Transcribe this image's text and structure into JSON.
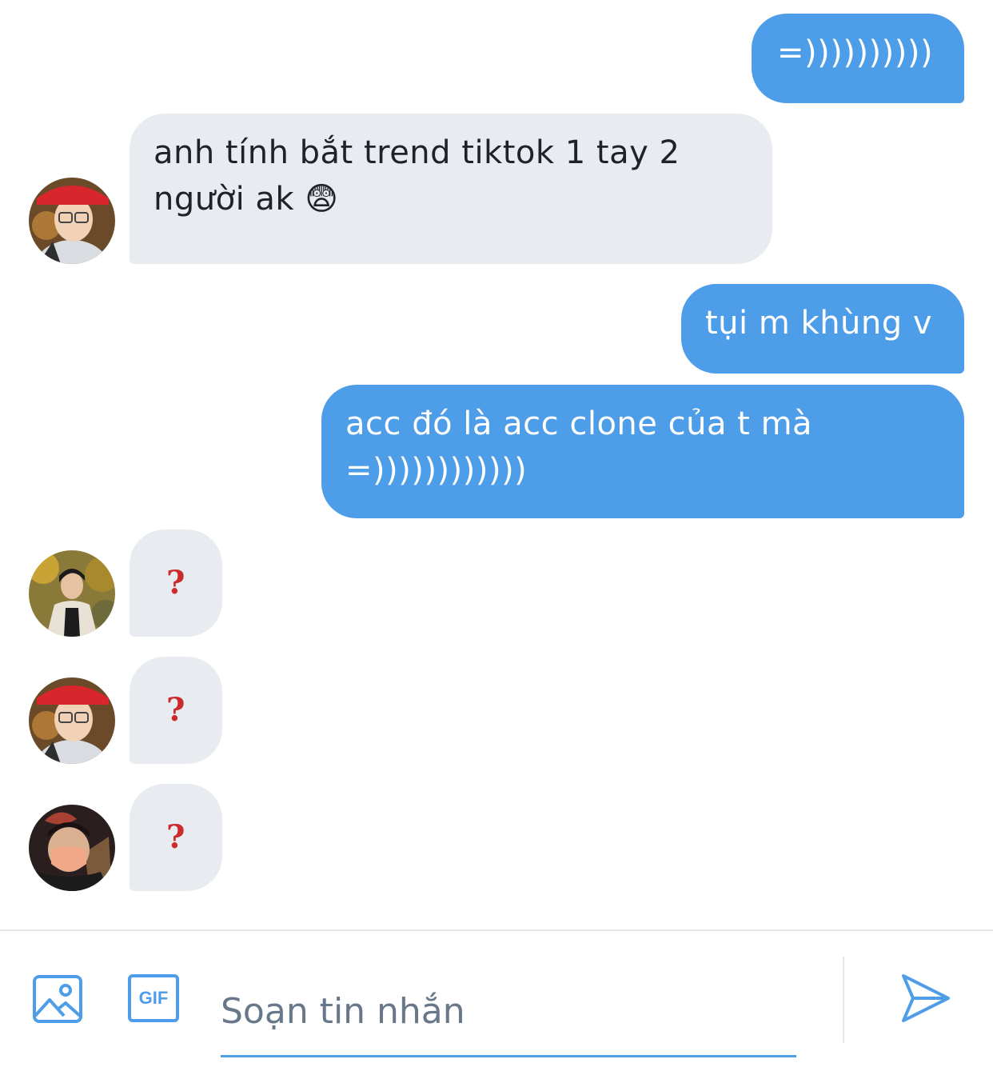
{
  "messages": [
    {
      "sender": "me",
      "text": "=))))))))))"
    },
    {
      "sender": "other",
      "text": "anh tính bắt trend tiktok 1 tay 2 người ak 😨"
    },
    {
      "sender": "me",
      "text": "tụi m khùng v"
    },
    {
      "sender": "me",
      "text": "acc đó là acc clone của t mà =))))))))))))"
    },
    {
      "sender": "other",
      "text": "?"
    },
    {
      "sender": "other",
      "text": "?"
    },
    {
      "sender": "other",
      "text": "?"
    }
  ],
  "composer": {
    "placeholder": "Soạn tin nhắn",
    "gif_label": "GIF",
    "icons": [
      "image-icon",
      "gif-icon",
      "send-icon"
    ]
  },
  "colors": {
    "accent": "#4d9de8",
    "received_bubble": "#e8ebef",
    "question_mark": "#cc2b2b",
    "placeholder": "#68788a"
  }
}
